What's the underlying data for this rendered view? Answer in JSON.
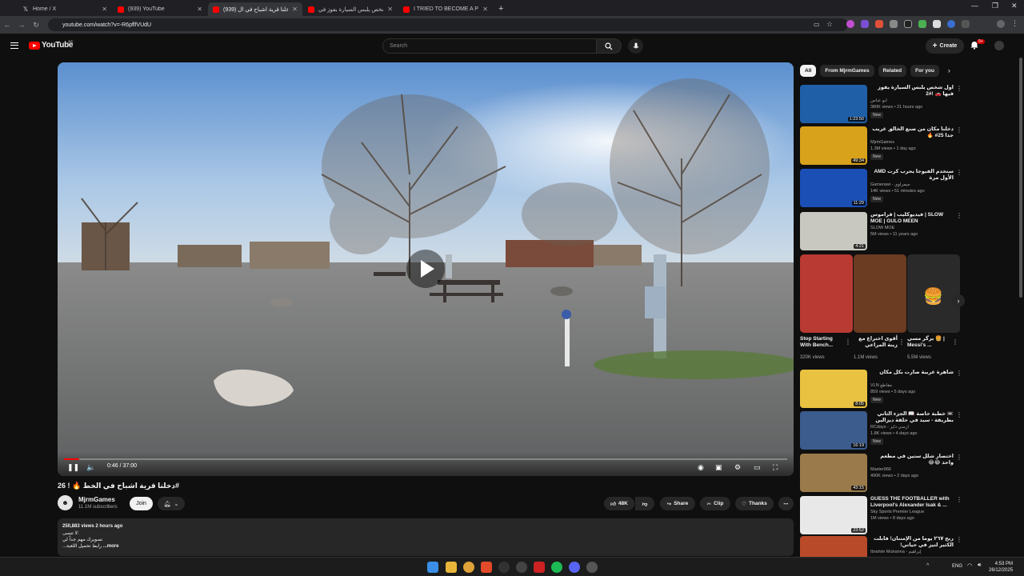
{
  "browser": {
    "tabs": [
      {
        "title": "Home / X",
        "icon": "x-logo-icon"
      },
      {
        "title": "(939) YouTube",
        "icon": "youtube-icon"
      },
      {
        "title": "(939) دخلنا قرية اشباح في ال",
        "icon": "youtube-icon"
      },
      {
        "title": "اول شخص يلبس السيارة يفوز في",
        "icon": "youtube-icon"
      },
      {
        "title": "I TRIED TO BECOME A PROFESS",
        "icon": "youtube-icon"
      }
    ],
    "url": "youtube.com/watch?v=-R6pflfVUdU"
  },
  "header": {
    "logo": "YouTube",
    "country": "AE",
    "search_placeholder": "Search",
    "create_label": "Create",
    "notifications": "9+"
  },
  "player": {
    "time": "0:46 / 37:00",
    "progress_fraction": 0.021
  },
  "video": {
    "title": "دخلنا قرية اشباح في الخط 🔥 ! 26#",
    "channel": "MjrmGames",
    "channel_avatar": "☻",
    "subscribers": "11.1M subscribers",
    "join_label": "Join",
    "likes": "48K",
    "share_label": "Share",
    "clip_label": "Clip",
    "thanks_label": "Thanks",
    "views_date": "250,883 views  2 hours ago",
    "desc_line1": "لا تنسى:",
    "desc_line2": "تصويرك مهم جداً لي",
    "desc_line3": "...رابط تحميل اللعبة",
    "more_label": "...more"
  },
  "chips": [
    "All",
    "From MjrmGames",
    "Related",
    "For you"
  ],
  "recommendations": [
    {
      "title": "اول شخص يلبس السيارة يفوز فيها 🚗 !#2",
      "channel": "ابو عباس",
      "meta": "380K views • 21 hours ago",
      "duration": "1:23:50",
      "new": "New",
      "color": "#1f5fa8"
    },
    {
      "title": "دخلنا مكان من صنع الخالق غريب جدا 25# 🔥",
      "channel": "MjrmGames",
      "meta": "1.3M views • 1 day ago",
      "duration": "49:34",
      "new": "New",
      "color": "#d9a21b"
    },
    {
      "title": "ستخدم الفيوجا يحرب كرت AMD الأول مرة",
      "channel": "Gamerawi - جيمراوي",
      "meta": "14K views • 51 minutes ago",
      "duration": "11:29",
      "new": "New",
      "color": "#1b4fb6"
    },
    {
      "title": "فيديوكليب | قرأموس | SLOW MOE | GULO MEEN",
      "channel": "SLOW MOE",
      "meta": "5M views • 11 years ago",
      "duration": "4:21",
      "new": "",
      "color": "#c8c8c0"
    }
  ],
  "shorts": [
    {
      "title": "Stop Starting With Bench...",
      "views": "320K views",
      "color": "#b83a32"
    },
    {
      "title": "أقوى اختراع مع زينة المراعي",
      "views": "1.1M views",
      "color": "#6b3b22"
    },
    {
      "title": "برگر مسي 🍔 | Messi's ...",
      "views": "5.5M views",
      "color": "#2a2a2a"
    }
  ],
  "recommendations2": [
    {
      "title": "شاهرة غريبة صارت بكل مكان",
      "channel": "VLN مقاطع",
      "meta": "859 views • 5 days ago",
      "duration": "8:05",
      "new": "New",
      "color": "#e8c240"
    },
    {
      "title": "📼 خطبة خاصة 📖 الجزء الثاني بطريقة - سيد في حلقة ديزالين السيارات الاسطورية",
      "channel": "RCdays - ارسي دايز",
      "meta": "1.8K views • 4 days ago",
      "duration": "16:19",
      "new": "New",
      "color": "#3b5c8c"
    },
    {
      "title": "اختصار شلل ستين في مطعم واحد 😂😂",
      "channel": "Master966",
      "meta": "490K views • 2 days ago",
      "duration": "43:15",
      "new": "",
      "color": "#9a7a4a"
    },
    {
      "title": "GUESS THE FOOTBALLER with Liverpool's Alexander Isak & ...",
      "channel": "Sky Sports Premier League",
      "meta": "1M views • 8 days ago",
      "duration": "23:52",
      "new": "",
      "color": "#e8e8e8"
    },
    {
      "title": "ربح ٢٦٧ يوماً من الإمتنان! فابلت الكثير لتيز في حياتي!",
      "channel": "Ibrahim Muhanna - إبراهيم",
      "meta": "",
      "duration": "",
      "new": "",
      "color": "#b84a2a"
    }
  ],
  "taskbar": {
    "lang": "ENG",
    "time": "4:53 PM",
    "date": "26/12/2025"
  },
  "colors": {
    "accent": "#ff0000",
    "bg": "#0f0f0f",
    "surface": "#272727"
  }
}
